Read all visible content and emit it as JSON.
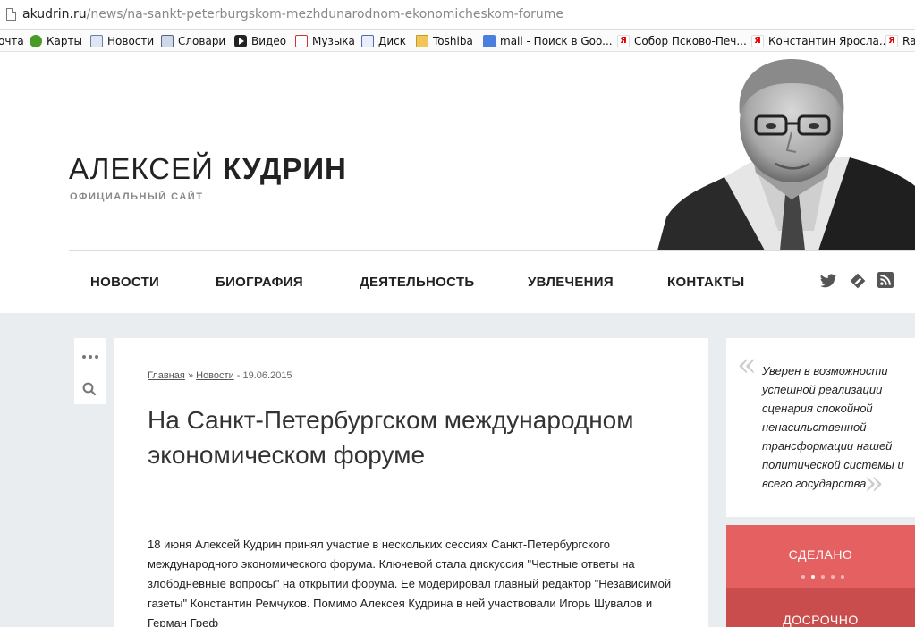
{
  "browser": {
    "url_host": "akudrin.ru",
    "url_path": "/news/na-sankt-peterburgskom-mezhdunarodnom-ekonomicheskom-forume",
    "bookmarks": [
      {
        "label": "очта",
        "icon": "mail-icon"
      },
      {
        "label": "Карты",
        "icon": "maps-icon"
      },
      {
        "label": "Новости",
        "icon": "news-icon"
      },
      {
        "label": "Словари",
        "icon": "dictionary-icon"
      },
      {
        "label": "Видео",
        "icon": "video-icon"
      },
      {
        "label": "Музыка",
        "icon": "music-icon"
      },
      {
        "label": "Диск",
        "icon": "disk-icon"
      },
      {
        "label": "Toshiba",
        "icon": "folder-icon"
      },
      {
        "label": "mail - Поиск в Goo...",
        "icon": "google-icon"
      },
      {
        "label": "Собор Псково-Печ...",
        "icon": "yandex-icon"
      },
      {
        "label": "Константин Яросла...",
        "icon": "yandex-icon"
      },
      {
        "label": "Ra",
        "icon": "yandex-icon"
      }
    ]
  },
  "site": {
    "title_first": "АЛЕКСЕЙ",
    "title_last": "КУДРИН",
    "subtitle": "ОФИЦИАЛЬНЫЙ САЙТ"
  },
  "nav": {
    "items": [
      "НОВОСТИ",
      "БИОГРАФИЯ",
      "ДЕЯТЕЛЬНОСТЬ",
      "УВЛЕЧЕНИЯ",
      "КОНТАКТЫ"
    ]
  },
  "article": {
    "crumb_home": "Главная",
    "crumb_sep": "»",
    "crumb_news": "Новости",
    "date": "- 19.06.2015",
    "title": "На Санкт-Петербургском международном экономическом форуме",
    "body": "18 июня Алексей Кудрин принял участие в нескольких сессиях Санкт-Петербургского международного экономического форума. Ключевой стала дискуссия \"Честные ответы на злободневные вопросы\" на открытии форума. Её модерировал главный редактор \"Независимой газеты\" Константин Ремчуков. Помимо Алексея Кудрина в ней участвовали Игорь Шувалов и Герман Греф"
  },
  "sidebar": {
    "quote": "Уверен в возможности успешной реализации сценария спокойной ненасильственной трансформации нашей политической системы и всего государства",
    "quote_open": "«",
    "quote_close": "»",
    "panel_1": "СДЕЛАНО",
    "panel_2": "ДОСРОЧНО",
    "pager_count": 5,
    "pager_active": 2
  },
  "colors": {
    "accent_red": "#e56060",
    "accent_red_dark": "#c94d4d",
    "page_grey": "#eaedf0"
  }
}
